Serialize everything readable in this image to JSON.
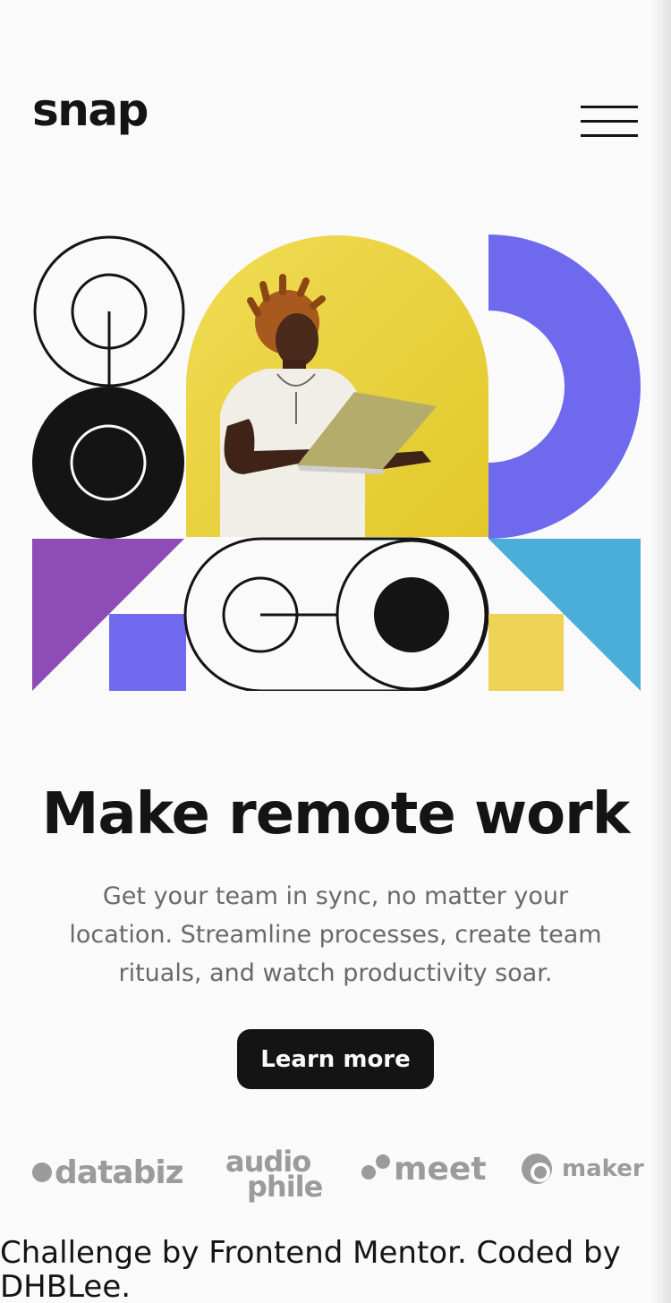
{
  "header": {
    "logo": "snap",
    "menu_icon": "hamburger-menu-icon"
  },
  "hero": {
    "title": "Make remote work",
    "description": "Get your team in sync, no matter your location. Streamline processes, create team rituals, and watch productivity soar.",
    "cta_label": "Learn more"
  },
  "clients": {
    "databiz": "databiz",
    "audio": "audio",
    "phile": "phile",
    "meet": "meet",
    "maker": "maker"
  },
  "footer": {
    "attribution": "Challenge by Frontend Mentor. Coded by DHBLee."
  },
  "colors": {
    "ink": "#141414",
    "background": "#fafafa",
    "gray": "#696969",
    "yellow": "#e8d537",
    "purple": "#6f69ee",
    "violet": "#8d4cb6",
    "cyan": "#4aaedb",
    "sand": "#eed357"
  }
}
